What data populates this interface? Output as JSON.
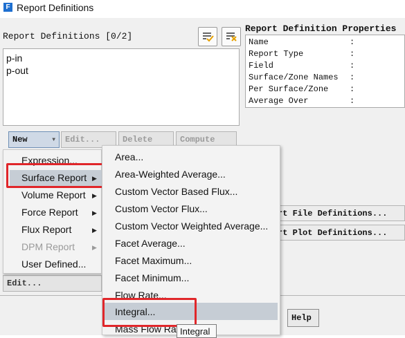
{
  "window": {
    "title": "Report Definitions",
    "app_icon_letter": "F"
  },
  "left_panel": {
    "label": "Report Definitions [0/2]",
    "items": [
      "p-in",
      "p-out"
    ],
    "buttons": {
      "new": "New",
      "edit": "Edit...",
      "delete": "Delete",
      "compute": "Compute"
    },
    "edit_bottom": "Edit..."
  },
  "properties": {
    "title": "Report Definition Properties",
    "rows": [
      {
        "name": "Name",
        "value": ":"
      },
      {
        "name": "Report Type",
        "value": ":"
      },
      {
        "name": "Field",
        "value": ":"
      },
      {
        "name": "Surface/Zone Names",
        "value": ":"
      },
      {
        "name": "Per Surface/Zone",
        "value": ":"
      },
      {
        "name": "Average Over",
        "value": ":"
      }
    ]
  },
  "right_sections": {
    "file_definitions": "rt File Definitions...",
    "plot_definitions": "rt Plot Definitions..."
  },
  "help_button": "Help",
  "new_menu": {
    "items": [
      {
        "label": "Expression...",
        "submenu": false,
        "disabled": false
      },
      {
        "label": "Surface Report",
        "submenu": true,
        "disabled": false,
        "highlighted": true
      },
      {
        "label": "Volume Report",
        "submenu": true,
        "disabled": false
      },
      {
        "label": "Force Report",
        "submenu": true,
        "disabled": false
      },
      {
        "label": "Flux Report",
        "submenu": true,
        "disabled": false
      },
      {
        "label": "DPM Report",
        "submenu": true,
        "disabled": true
      },
      {
        "label": "User Defined...",
        "submenu": false,
        "disabled": false
      }
    ]
  },
  "surface_submenu": {
    "items": [
      "Area...",
      "Area-Weighted Average...",
      "Custom Vector Based Flux...",
      "Custom Vector Flux...",
      "Custom Vector Weighted Average...",
      "Facet Average...",
      "Facet Maximum...",
      "Facet Minimum...",
      "Flow Rate...",
      "Integral...",
      "Mass Flow Rate..."
    ],
    "highlighted_index": 9
  },
  "tooltip": "Integral",
  "colors": {
    "highlight": "#c6cdd5",
    "annotation_red": "#e0262a",
    "panel_bg": "#f0f0f0"
  }
}
